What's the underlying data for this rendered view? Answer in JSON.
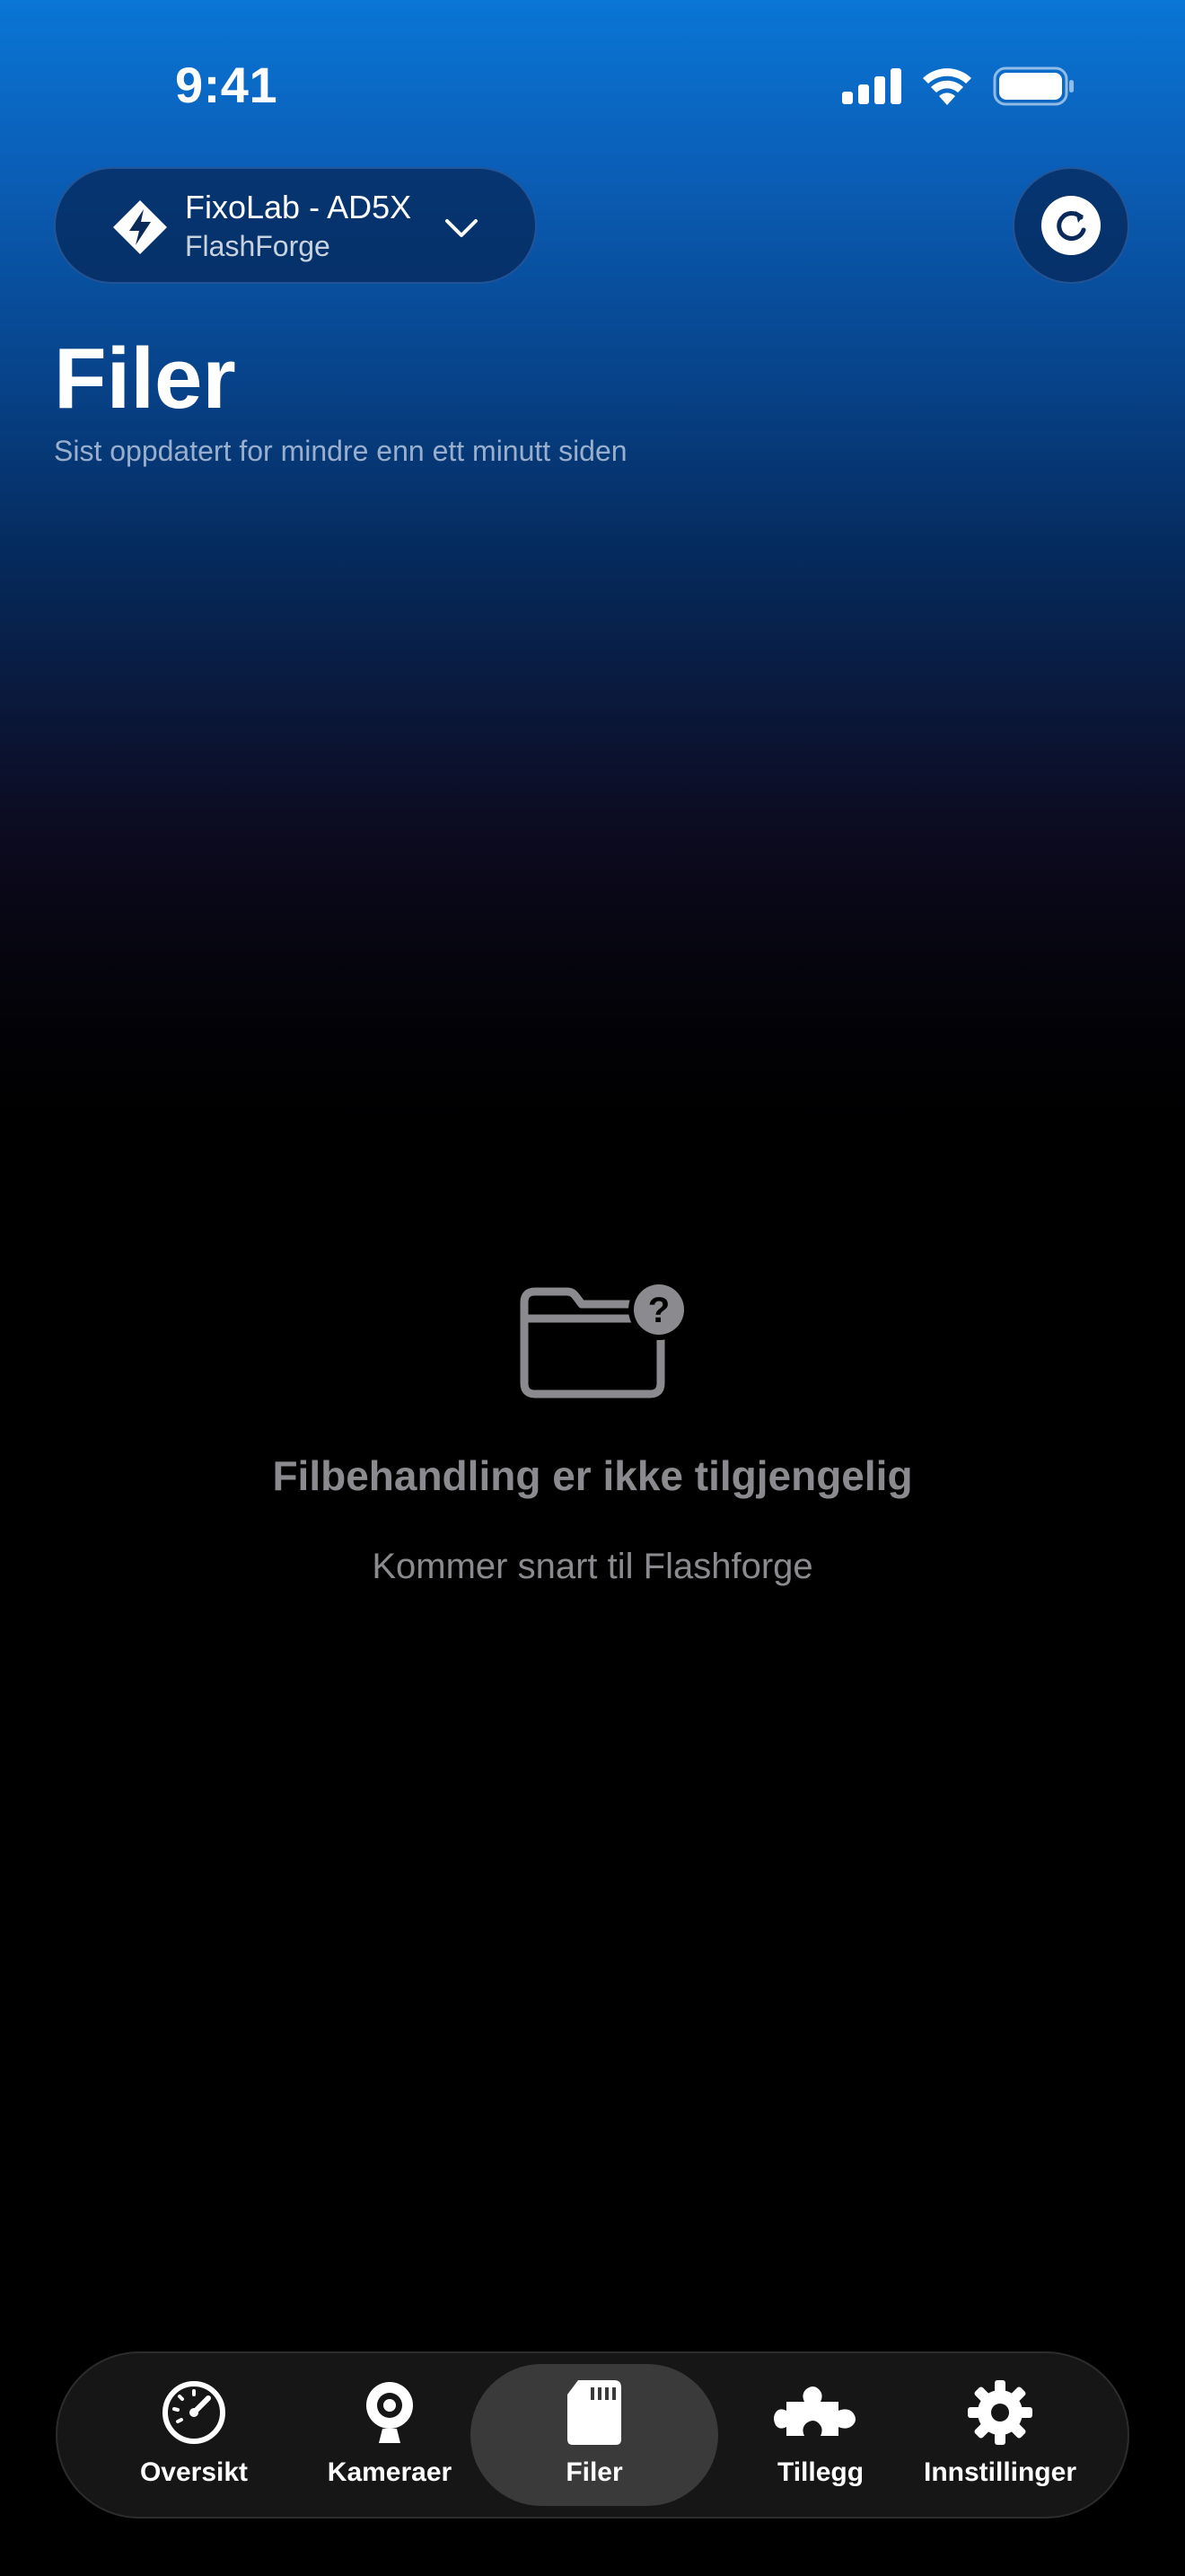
{
  "status_bar": {
    "time": "9:41"
  },
  "printer_selector": {
    "name": "FixoLab - AD5X",
    "brand": "FlashForge",
    "icon": "flashforge-logo-icon"
  },
  "header": {
    "title": "Filer",
    "subtitle": "Sist oppdatert for mindre enn ett minutt siden"
  },
  "empty_state": {
    "icon": "folder-question-icon",
    "title": "Filbehandling er ikke tilgjengelig",
    "subtitle": "Kommer snart til Flashforge"
  },
  "tab_bar": {
    "active": "Filer",
    "tabs": [
      {
        "label": "Oversikt",
        "icon": "speedometer-icon"
      },
      {
        "label": "Kameraer",
        "icon": "webcam-icon"
      },
      {
        "label": "Filer",
        "icon": "sd-card-icon"
      },
      {
        "label": "Tillegg",
        "icon": "puzzle-icon"
      },
      {
        "label": "Innstillinger",
        "icon": "gear-icon"
      }
    ]
  },
  "colors": {
    "accent_top": "#0a76d6",
    "background": "#000000",
    "muted_text": "#8a8a8f",
    "tab_bar_bg": "#161616",
    "tab_active_bg": "#3a3a3a"
  }
}
